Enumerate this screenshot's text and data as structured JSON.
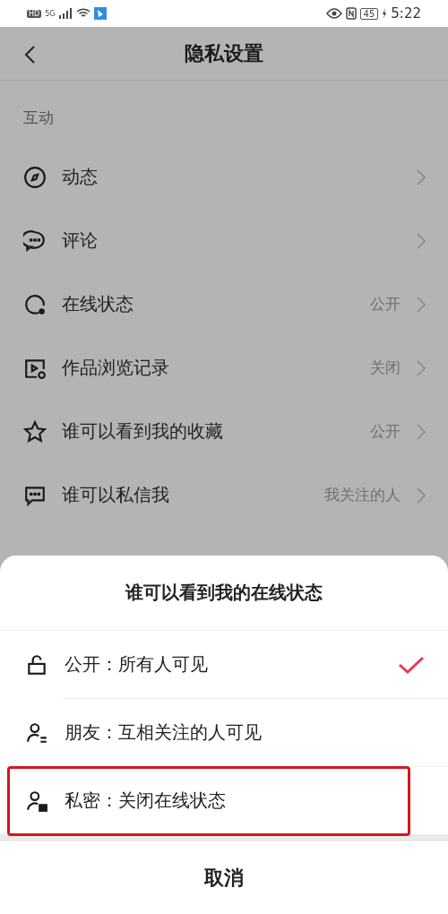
{
  "status_bar": {
    "network_badge": "HD",
    "network_type": "5G",
    "battery": "45",
    "time": "5:22"
  },
  "nav": {
    "title": "隐私设置"
  },
  "section": {
    "label": "互动"
  },
  "rows": [
    {
      "label": "动态"
    },
    {
      "label": "评论"
    },
    {
      "label": "在线状态",
      "value": "公开"
    },
    {
      "label": "作品浏览记录",
      "value": "关闭"
    },
    {
      "label": "谁可以看到我的收藏",
      "value": "公开"
    },
    {
      "label": "谁可以私信我",
      "value": "我关注的人"
    }
  ],
  "sheet": {
    "title": "谁可以看到我的在线状态",
    "options": [
      {
        "label": "公开：所有人可见",
        "selected": true
      },
      {
        "label": "朋友：互相关注的人可见",
        "selected": false
      },
      {
        "label": "私密：关闭在线状态",
        "selected": false,
        "highlighted": true
      }
    ],
    "cancel": "取消"
  }
}
